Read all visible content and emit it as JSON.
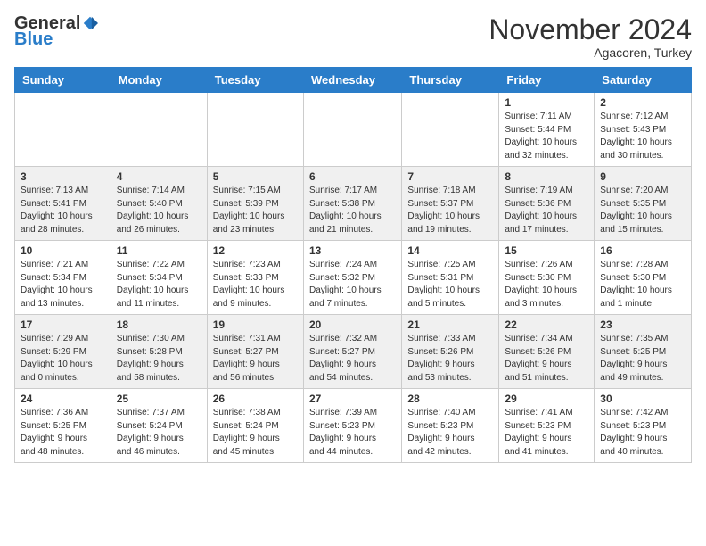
{
  "header": {
    "logo_general": "General",
    "logo_blue": "Blue",
    "month": "November 2024",
    "location": "Agacoren, Turkey"
  },
  "days_of_week": [
    "Sunday",
    "Monday",
    "Tuesday",
    "Wednesday",
    "Thursday",
    "Friday",
    "Saturday"
  ],
  "weeks": [
    [
      {
        "day": "",
        "info": ""
      },
      {
        "day": "",
        "info": ""
      },
      {
        "day": "",
        "info": ""
      },
      {
        "day": "",
        "info": ""
      },
      {
        "day": "",
        "info": ""
      },
      {
        "day": "1",
        "info": "Sunrise: 7:11 AM\nSunset: 5:44 PM\nDaylight: 10 hours\nand 32 minutes."
      },
      {
        "day": "2",
        "info": "Sunrise: 7:12 AM\nSunset: 5:43 PM\nDaylight: 10 hours\nand 30 minutes."
      }
    ],
    [
      {
        "day": "3",
        "info": "Sunrise: 7:13 AM\nSunset: 5:41 PM\nDaylight: 10 hours\nand 28 minutes."
      },
      {
        "day": "4",
        "info": "Sunrise: 7:14 AM\nSunset: 5:40 PM\nDaylight: 10 hours\nand 26 minutes."
      },
      {
        "day": "5",
        "info": "Sunrise: 7:15 AM\nSunset: 5:39 PM\nDaylight: 10 hours\nand 23 minutes."
      },
      {
        "day": "6",
        "info": "Sunrise: 7:17 AM\nSunset: 5:38 PM\nDaylight: 10 hours\nand 21 minutes."
      },
      {
        "day": "7",
        "info": "Sunrise: 7:18 AM\nSunset: 5:37 PM\nDaylight: 10 hours\nand 19 minutes."
      },
      {
        "day": "8",
        "info": "Sunrise: 7:19 AM\nSunset: 5:36 PM\nDaylight: 10 hours\nand 17 minutes."
      },
      {
        "day": "9",
        "info": "Sunrise: 7:20 AM\nSunset: 5:35 PM\nDaylight: 10 hours\nand 15 minutes."
      }
    ],
    [
      {
        "day": "10",
        "info": "Sunrise: 7:21 AM\nSunset: 5:34 PM\nDaylight: 10 hours\nand 13 minutes."
      },
      {
        "day": "11",
        "info": "Sunrise: 7:22 AM\nSunset: 5:34 PM\nDaylight: 10 hours\nand 11 minutes."
      },
      {
        "day": "12",
        "info": "Sunrise: 7:23 AM\nSunset: 5:33 PM\nDaylight: 10 hours\nand 9 minutes."
      },
      {
        "day": "13",
        "info": "Sunrise: 7:24 AM\nSunset: 5:32 PM\nDaylight: 10 hours\nand 7 minutes."
      },
      {
        "day": "14",
        "info": "Sunrise: 7:25 AM\nSunset: 5:31 PM\nDaylight: 10 hours\nand 5 minutes."
      },
      {
        "day": "15",
        "info": "Sunrise: 7:26 AM\nSunset: 5:30 PM\nDaylight: 10 hours\nand 3 minutes."
      },
      {
        "day": "16",
        "info": "Sunrise: 7:28 AM\nSunset: 5:30 PM\nDaylight: 10 hours\nand 1 minute."
      }
    ],
    [
      {
        "day": "17",
        "info": "Sunrise: 7:29 AM\nSunset: 5:29 PM\nDaylight: 10 hours\nand 0 minutes."
      },
      {
        "day": "18",
        "info": "Sunrise: 7:30 AM\nSunset: 5:28 PM\nDaylight: 9 hours\nand 58 minutes."
      },
      {
        "day": "19",
        "info": "Sunrise: 7:31 AM\nSunset: 5:27 PM\nDaylight: 9 hours\nand 56 minutes."
      },
      {
        "day": "20",
        "info": "Sunrise: 7:32 AM\nSunset: 5:27 PM\nDaylight: 9 hours\nand 54 minutes."
      },
      {
        "day": "21",
        "info": "Sunrise: 7:33 AM\nSunset: 5:26 PM\nDaylight: 9 hours\nand 53 minutes."
      },
      {
        "day": "22",
        "info": "Sunrise: 7:34 AM\nSunset: 5:26 PM\nDaylight: 9 hours\nand 51 minutes."
      },
      {
        "day": "23",
        "info": "Sunrise: 7:35 AM\nSunset: 5:25 PM\nDaylight: 9 hours\nand 49 minutes."
      }
    ],
    [
      {
        "day": "24",
        "info": "Sunrise: 7:36 AM\nSunset: 5:25 PM\nDaylight: 9 hours\nand 48 minutes."
      },
      {
        "day": "25",
        "info": "Sunrise: 7:37 AM\nSunset: 5:24 PM\nDaylight: 9 hours\nand 46 minutes."
      },
      {
        "day": "26",
        "info": "Sunrise: 7:38 AM\nSunset: 5:24 PM\nDaylight: 9 hours\nand 45 minutes."
      },
      {
        "day": "27",
        "info": "Sunrise: 7:39 AM\nSunset: 5:23 PM\nDaylight: 9 hours\nand 44 minutes."
      },
      {
        "day": "28",
        "info": "Sunrise: 7:40 AM\nSunset: 5:23 PM\nDaylight: 9 hours\nand 42 minutes."
      },
      {
        "day": "29",
        "info": "Sunrise: 7:41 AM\nSunset: 5:23 PM\nDaylight: 9 hours\nand 41 minutes."
      },
      {
        "day": "30",
        "info": "Sunrise: 7:42 AM\nSunset: 5:23 PM\nDaylight: 9 hours\nand 40 minutes."
      }
    ]
  ]
}
